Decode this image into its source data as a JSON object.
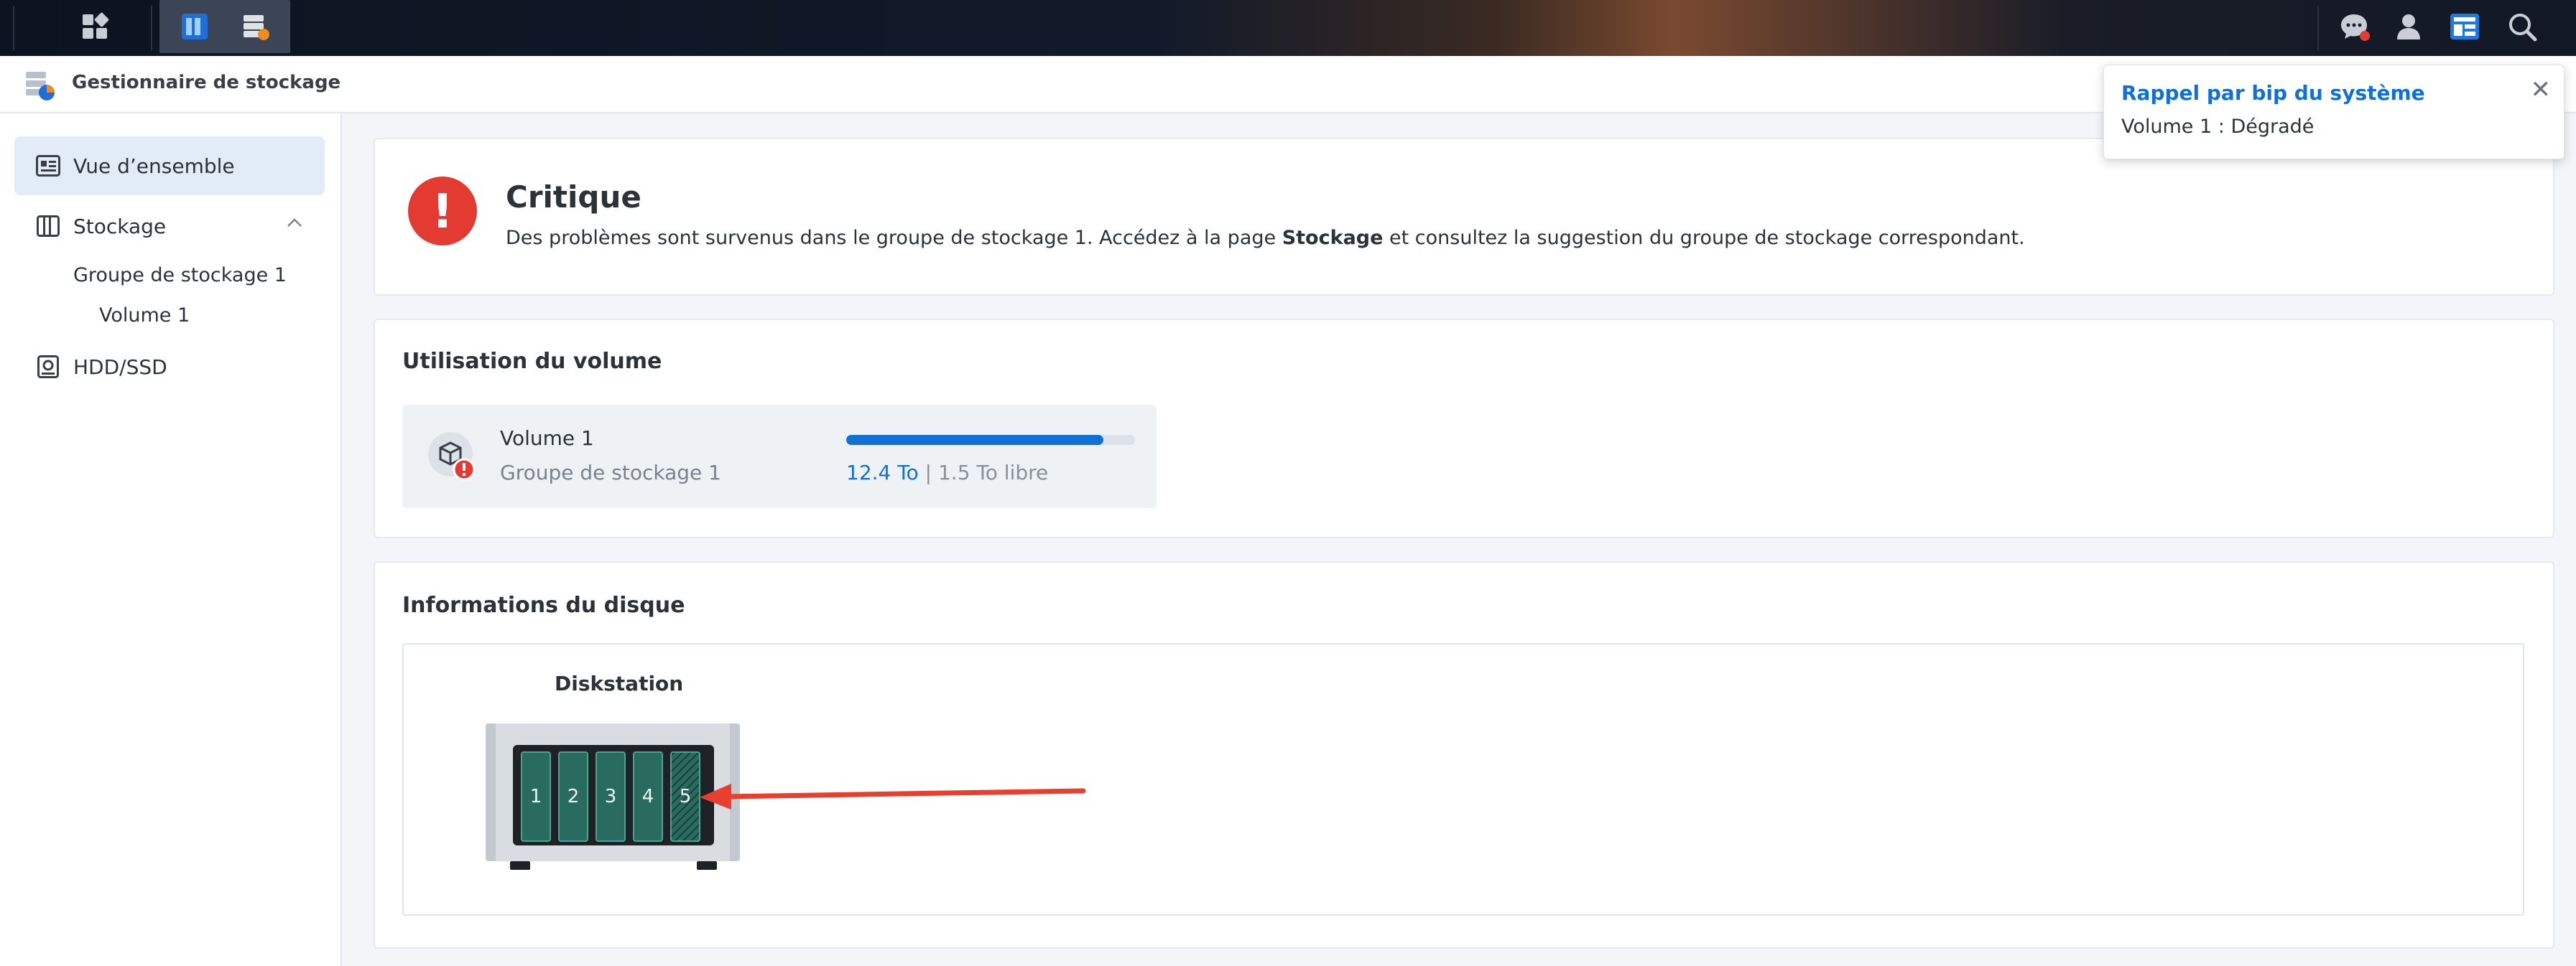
{
  "app": {
    "title": "Gestionnaire de stockage"
  },
  "taskbar": {
    "left_icons": [
      "apps-grid-icon",
      "storage-manager-icon",
      "storage-app-icon"
    ],
    "right_icons": [
      "notification-icon",
      "user-icon",
      "widgets-icon",
      "search-icon"
    ]
  },
  "sidebar": {
    "items": [
      {
        "label": "Vue d’ensemble",
        "icon": "overview-icon",
        "active": true
      },
      {
        "label": "Stockage",
        "icon": "storage-icon",
        "expanded": true
      },
      {
        "label": "Groupe de stockage 1"
      },
      {
        "label": "Volume 1"
      },
      {
        "label": "HDD/SSD",
        "icon": "hdd-icon"
      }
    ]
  },
  "status": {
    "title": "Critique",
    "message_pre": "Des problèmes sont survenus dans le groupe de stockage 1. Accédez à la page ",
    "message_bold": "Stockage",
    "message_post": " et consultez la suggestion du groupe de stockage correspondant.",
    "color": "#e33b32"
  },
  "volume_section": {
    "title": "Utilisation du volume",
    "volume_name": "Volume 1",
    "pool_name": "Groupe de stockage 1",
    "used": "12.4 To",
    "separator": "|",
    "free": "1.5 To libre",
    "usage_fraction": 0.89,
    "accent": "#1170d6"
  },
  "disk_section": {
    "title": "Informations du disque",
    "device_name": "Diskstation",
    "bays": [
      "1",
      "2",
      "3",
      "4",
      "5"
    ],
    "faulty_bay": "5"
  },
  "toast": {
    "title": "Rappel par bip du système",
    "message": "Volume 1 : Dégradé",
    "close": "✕"
  }
}
